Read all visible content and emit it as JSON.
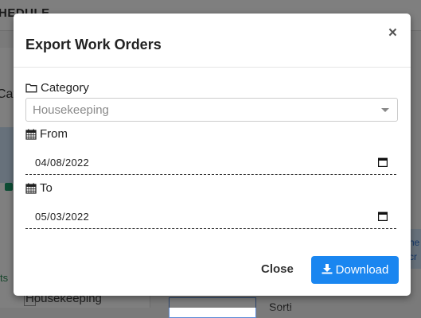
{
  "background": {
    "header_fragment": "HEDULE",
    "category_fragment": "Cat",
    "link_fragment": "ts",
    "list_item": "Housekeeping",
    "sort_fragment": "Sorti",
    "card_fragment_1": "he",
    "card_fragment_2": "cr"
  },
  "modal": {
    "title": "Export Work Orders",
    "close_icon": "×",
    "category": {
      "icon": "folder-icon",
      "label": "Category",
      "selected": "Housekeeping"
    },
    "from": {
      "icon": "calendar-icon",
      "label": "From",
      "value": "04/08/2022"
    },
    "to": {
      "icon": "calendar-icon",
      "label": "To",
      "value": "05/03/2022"
    },
    "close_button": "Close",
    "download_button": "Download",
    "download_icon": "download-icon"
  },
  "colors": {
    "primary": "#1a86f0",
    "backdrop": "rgba(0,0,0,0.5)"
  }
}
